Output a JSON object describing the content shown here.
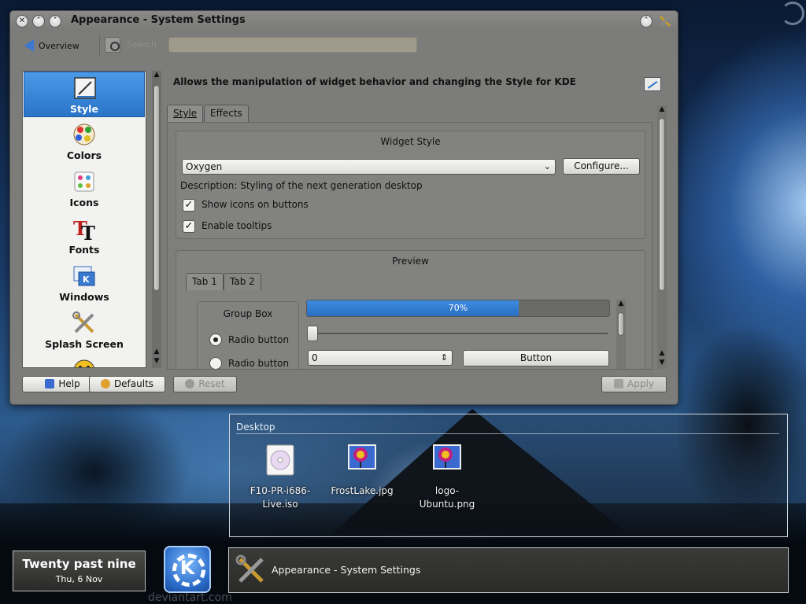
{
  "window": {
    "title": "Appearance - System Settings",
    "buttons": {
      "close": "✕",
      "minimize": "˄",
      "maximize": "˅",
      "shade": "˄"
    }
  },
  "toolbar": {
    "overview_label": "Overview",
    "search_label": "Search:",
    "search_value": ""
  },
  "sidebar": {
    "items": [
      {
        "label": "Style",
        "icon": "style-icon",
        "selected": true
      },
      {
        "label": "Colors",
        "icon": "colors-icon",
        "selected": false
      },
      {
        "label": "Icons",
        "icon": "icons-icon",
        "selected": false
      },
      {
        "label": "Fonts",
        "icon": "fonts-icon",
        "selected": false
      },
      {
        "label": "Windows",
        "icon": "windows-icon",
        "selected": false
      },
      {
        "label": "Splash Screen",
        "icon": "splash-screen-icon",
        "selected": false
      },
      {
        "label": "",
        "icon": "emoticons-icon",
        "selected": false
      }
    ]
  },
  "header": {
    "description": "Allows the manipulation of widget behavior and changing the Style for KDE"
  },
  "tabs": [
    {
      "label": "Style",
      "selected": true
    },
    {
      "label": "Effects",
      "selected": false
    }
  ],
  "widget_style": {
    "group_title": "Widget Style",
    "combo_value": "Oxygen",
    "configure_label": "Configure...",
    "description": "Description: Styling of the next generation desktop",
    "show_icons_label": "Show icons on buttons",
    "show_icons_checked": true,
    "tooltips_label": "Enable tooltips",
    "tooltips_checked": true
  },
  "preview": {
    "group_title": "Preview",
    "tabs": [
      {
        "label": "Tab 1",
        "selected": true
      },
      {
        "label": "Tab 2",
        "selected": false
      }
    ],
    "group_box_title": "Group Box",
    "radio_1_label": "Radio button",
    "radio_2_label": "Radio button",
    "progress_percent": 70,
    "progress_label": "70%",
    "slider_value": 0,
    "spin_value": "0",
    "button_label": "Button"
  },
  "bottom": {
    "help_label": "Help",
    "defaults_label": "Defaults",
    "reset_label": "Reset",
    "apply_label": "Apply"
  },
  "desktop": {
    "title": "Desktop",
    "files": [
      {
        "name": "F10-PR-i686-Live.iso",
        "icon": "disc-image-icon"
      },
      {
        "name": "FrostLake.jpg",
        "icon": "image-file-icon"
      },
      {
        "name": "logo-Ubuntu.png",
        "icon": "image-file-icon"
      }
    ]
  },
  "panel": {
    "clock_time": "Twenty past nine",
    "clock_date": "Thu, 6 Nov",
    "task_label": "Appearance - System Settings",
    "watermark": "deviantart.com"
  },
  "colors": {
    "selection": "#2a74c8",
    "progress": "#3c8ce0"
  }
}
